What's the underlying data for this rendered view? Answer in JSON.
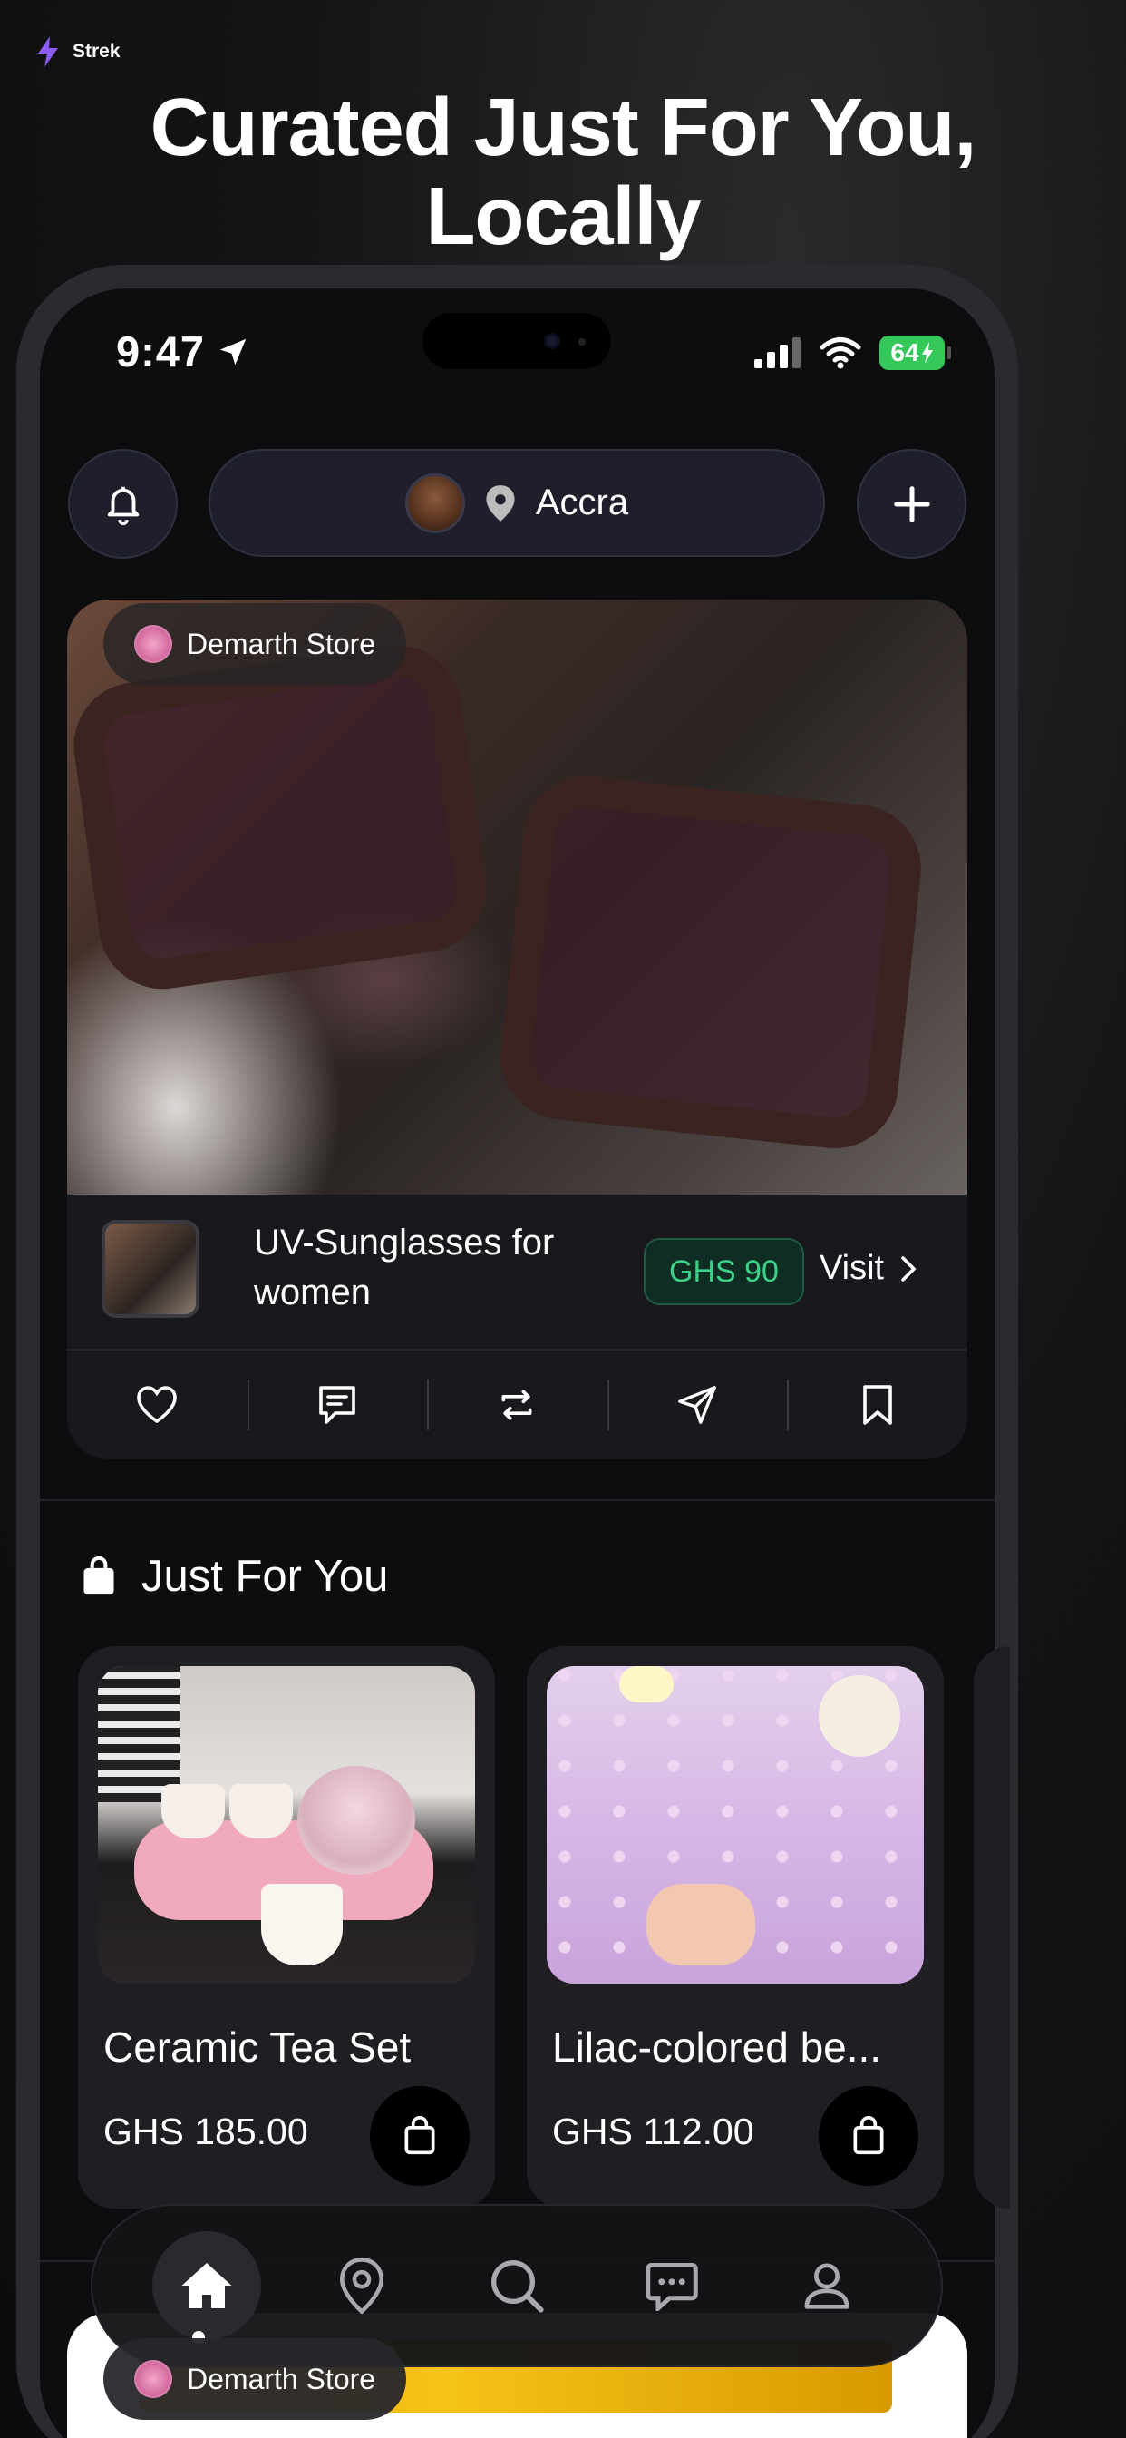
{
  "brand": {
    "name": "Strek",
    "icon": "bolt-icon",
    "accent": "#8b5cf6"
  },
  "headline": {
    "line1": "Curated Just For You,",
    "line2": "Locally"
  },
  "status_bar": {
    "time": "9:47",
    "battery": "64"
  },
  "top_bar": {
    "location": "Accra"
  },
  "post": {
    "store_name": "Demarth Store",
    "product_title": "UV-Sunglasses for women",
    "price": "GHS 90",
    "visit_label": "Visit",
    "price_color": "#3cd188"
  },
  "section": {
    "title": "Just For You"
  },
  "products": [
    {
      "name": "Ceramic Tea Set",
      "price": "GHS 185.00"
    },
    {
      "name": "Lilac-colored be...",
      "price": "GHS 112.00"
    }
  ],
  "next_post": {
    "store_name": "Demarth Store"
  },
  "nav": {
    "items": [
      "home-icon",
      "map-pin-icon",
      "search-icon",
      "chat-icon",
      "profile-icon"
    ],
    "active": "home-icon"
  }
}
